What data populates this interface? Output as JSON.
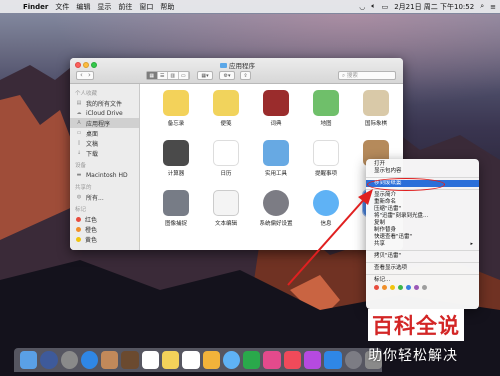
{
  "menubar": {
    "apple": "",
    "items": [
      "Finder",
      "文件",
      "编辑",
      "显示",
      "前往",
      "窗口",
      "帮助"
    ],
    "date_time": "2月21日 周二 下午10:52"
  },
  "window": {
    "title": "应用程序",
    "search_placeholder": "搜索"
  },
  "sidebar": {
    "sections": [
      {
        "head": "个人收藏",
        "items": [
          "我的所有文件",
          "iCloud Drive",
          "应用程序",
          "桌面",
          "文稿",
          "下载"
        ]
      },
      {
        "head": "设备",
        "items": [
          "Macintosh HD"
        ]
      },
      {
        "head": "共享的",
        "items": [
          "所有..."
        ]
      },
      {
        "head": "标记",
        "items": [
          "红色",
          "橙色",
          "黄色"
        ]
      }
    ]
  },
  "apps": [
    {
      "label": "备忘录",
      "color": "#f3d25a"
    },
    {
      "label": "便笺",
      "color": "#f1d35c"
    },
    {
      "label": "词典",
      "color": "#9a2c2c"
    },
    {
      "label": "地图",
      "color": "#6fbf6a"
    },
    {
      "label": "国际象棋",
      "color": "#d9c9a8"
    },
    {
      "label": "计算器",
      "color": "#4a4a4a"
    },
    {
      "label": "日历",
      "color": "#ffffff"
    },
    {
      "label": "实用工具",
      "color": "#67a9e3"
    },
    {
      "label": "提醒事项",
      "color": "#ffffff"
    },
    {
      "label": "通讯录",
      "color": "#b58a5b"
    },
    {
      "label": "图像捕捉",
      "color": "#777c86"
    },
    {
      "label": "文本编辑",
      "color": "#f4f4f4"
    },
    {
      "label": "系统偏好设置",
      "color": "#7c7c84"
    },
    {
      "label": "信息",
      "color": "#5fb2f5"
    },
    {
      "label": "",
      "color": "#4a86e2"
    }
  ],
  "context_menu": {
    "items": [
      "打开",
      "显示包内容",
      "移到废纸篓",
      "显示简介",
      "重新命名",
      "压缩\"迅雷\"",
      "将\"迅雷\"刻录到光盘...",
      "复制",
      "制作替身",
      "快速查看\"迅雷\"",
      "共享",
      "拷贝\"迅雷\"",
      "查看显示选项",
      "标记..."
    ],
    "highlighted": "移到废纸篓",
    "tag_colors": [
      "#e84c3d",
      "#f08f2a",
      "#f1c40f",
      "#3cb64a",
      "#3a7fe0",
      "#9b59b6",
      "#9e9e9e"
    ]
  },
  "watermark": {
    "top": "百科全说",
    "bottom": "助你轻松解决"
  },
  "dock_colors": [
    "#5aa0e6",
    "#3e5a9a",
    "#8a8a8a",
    "#2f87e6",
    "#c2895a",
    "#6b4a2f",
    "#ffffff",
    "#f3d25a",
    "#ffffff",
    "#f2b33a",
    "#5fb2f5",
    "#2aa94b",
    "#e44a8c",
    "#f04a5a",
    "#b54ae0",
    "#2f87e6",
    "#7c7c84",
    "#8a8a8a"
  ]
}
